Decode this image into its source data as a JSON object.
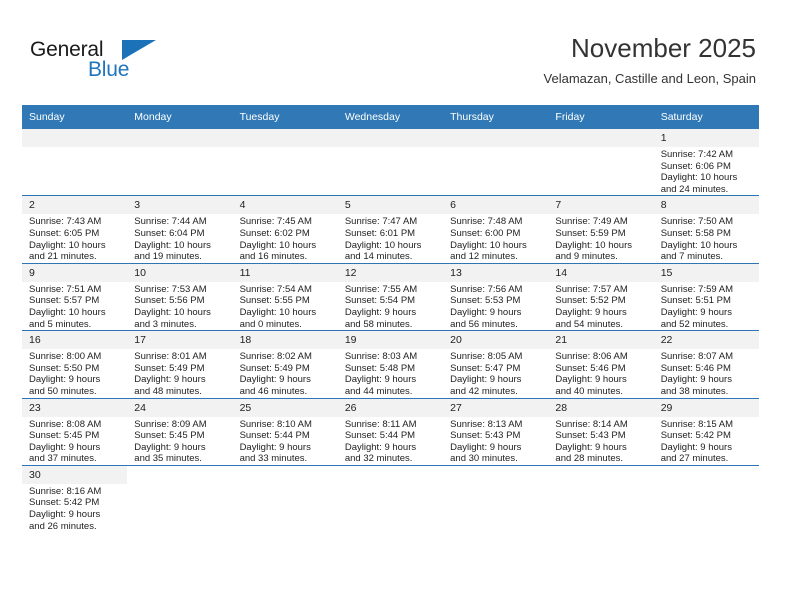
{
  "brand": {
    "name_part1": "General",
    "name_part2": "Blue",
    "accent_color": "#2175bd",
    "triangle_icon": "triangle-icon"
  },
  "header": {
    "title": "November 2025",
    "subtitle": "Velamazan, Castille and Leon, Spain"
  },
  "calendar": {
    "header_bg": "#3079b6",
    "row_line_color": "#2e75b6",
    "daynum_bg": "#f2f2f2",
    "weekdays": [
      "Sunday",
      "Monday",
      "Tuesday",
      "Wednesday",
      "Thursday",
      "Friday",
      "Saturday"
    ],
    "weeks": [
      [
        {
          "day": "",
          "lines": [],
          "empty": true
        },
        {
          "day": "",
          "lines": [],
          "empty": true
        },
        {
          "day": "",
          "lines": [],
          "empty": true
        },
        {
          "day": "",
          "lines": [],
          "empty": true
        },
        {
          "day": "",
          "lines": [],
          "empty": true
        },
        {
          "day": "",
          "lines": [],
          "empty": true
        },
        {
          "day": "1",
          "lines": [
            "Sunrise: 7:42 AM",
            "Sunset: 6:06 PM",
            "Daylight: 10 hours",
            "and 24 minutes."
          ]
        }
      ],
      [
        {
          "day": "2",
          "lines": [
            "Sunrise: 7:43 AM",
            "Sunset: 6:05 PM",
            "Daylight: 10 hours",
            "and 21 minutes."
          ]
        },
        {
          "day": "3",
          "lines": [
            "Sunrise: 7:44 AM",
            "Sunset: 6:04 PM",
            "Daylight: 10 hours",
            "and 19 minutes."
          ]
        },
        {
          "day": "4",
          "lines": [
            "Sunrise: 7:45 AM",
            "Sunset: 6:02 PM",
            "Daylight: 10 hours",
            "and 16 minutes."
          ]
        },
        {
          "day": "5",
          "lines": [
            "Sunrise: 7:47 AM",
            "Sunset: 6:01 PM",
            "Daylight: 10 hours",
            "and 14 minutes."
          ]
        },
        {
          "day": "6",
          "lines": [
            "Sunrise: 7:48 AM",
            "Sunset: 6:00 PM",
            "Daylight: 10 hours",
            "and 12 minutes."
          ]
        },
        {
          "day": "7",
          "lines": [
            "Sunrise: 7:49 AM",
            "Sunset: 5:59 PM",
            "Daylight: 10 hours",
            "and 9 minutes."
          ]
        },
        {
          "day": "8",
          "lines": [
            "Sunrise: 7:50 AM",
            "Sunset: 5:58 PM",
            "Daylight: 10 hours",
            "and 7 minutes."
          ]
        }
      ],
      [
        {
          "day": "9",
          "lines": [
            "Sunrise: 7:51 AM",
            "Sunset: 5:57 PM",
            "Daylight: 10 hours",
            "and 5 minutes."
          ]
        },
        {
          "day": "10",
          "lines": [
            "Sunrise: 7:53 AM",
            "Sunset: 5:56 PM",
            "Daylight: 10 hours",
            "and 3 minutes."
          ]
        },
        {
          "day": "11",
          "lines": [
            "Sunrise: 7:54 AM",
            "Sunset: 5:55 PM",
            "Daylight: 10 hours",
            "and 0 minutes."
          ]
        },
        {
          "day": "12",
          "lines": [
            "Sunrise: 7:55 AM",
            "Sunset: 5:54 PM",
            "Daylight: 9 hours",
            "and 58 minutes."
          ]
        },
        {
          "day": "13",
          "lines": [
            "Sunrise: 7:56 AM",
            "Sunset: 5:53 PM",
            "Daylight: 9 hours",
            "and 56 minutes."
          ]
        },
        {
          "day": "14",
          "lines": [
            "Sunrise: 7:57 AM",
            "Sunset: 5:52 PM",
            "Daylight: 9 hours",
            "and 54 minutes."
          ]
        },
        {
          "day": "15",
          "lines": [
            "Sunrise: 7:59 AM",
            "Sunset: 5:51 PM",
            "Daylight: 9 hours",
            "and 52 minutes."
          ]
        }
      ],
      [
        {
          "day": "16",
          "lines": [
            "Sunrise: 8:00 AM",
            "Sunset: 5:50 PM",
            "Daylight: 9 hours",
            "and 50 minutes."
          ]
        },
        {
          "day": "17",
          "lines": [
            "Sunrise: 8:01 AM",
            "Sunset: 5:49 PM",
            "Daylight: 9 hours",
            "and 48 minutes."
          ]
        },
        {
          "day": "18",
          "lines": [
            "Sunrise: 8:02 AM",
            "Sunset: 5:49 PM",
            "Daylight: 9 hours",
            "and 46 minutes."
          ]
        },
        {
          "day": "19",
          "lines": [
            "Sunrise: 8:03 AM",
            "Sunset: 5:48 PM",
            "Daylight: 9 hours",
            "and 44 minutes."
          ]
        },
        {
          "day": "20",
          "lines": [
            "Sunrise: 8:05 AM",
            "Sunset: 5:47 PM",
            "Daylight: 9 hours",
            "and 42 minutes."
          ]
        },
        {
          "day": "21",
          "lines": [
            "Sunrise: 8:06 AM",
            "Sunset: 5:46 PM",
            "Daylight: 9 hours",
            "and 40 minutes."
          ]
        },
        {
          "day": "22",
          "lines": [
            "Sunrise: 8:07 AM",
            "Sunset: 5:46 PM",
            "Daylight: 9 hours",
            "and 38 minutes."
          ]
        }
      ],
      [
        {
          "day": "23",
          "lines": [
            "Sunrise: 8:08 AM",
            "Sunset: 5:45 PM",
            "Daylight: 9 hours",
            "and 37 minutes."
          ]
        },
        {
          "day": "24",
          "lines": [
            "Sunrise: 8:09 AM",
            "Sunset: 5:45 PM",
            "Daylight: 9 hours",
            "and 35 minutes."
          ]
        },
        {
          "day": "25",
          "lines": [
            "Sunrise: 8:10 AM",
            "Sunset: 5:44 PM",
            "Daylight: 9 hours",
            "and 33 minutes."
          ]
        },
        {
          "day": "26",
          "lines": [
            "Sunrise: 8:11 AM",
            "Sunset: 5:44 PM",
            "Daylight: 9 hours",
            "and 32 minutes."
          ]
        },
        {
          "day": "27",
          "lines": [
            "Sunrise: 8:13 AM",
            "Sunset: 5:43 PM",
            "Daylight: 9 hours",
            "and 30 minutes."
          ]
        },
        {
          "day": "28",
          "lines": [
            "Sunrise: 8:14 AM",
            "Sunset: 5:43 PM",
            "Daylight: 9 hours",
            "and 28 minutes."
          ]
        },
        {
          "day": "29",
          "lines": [
            "Sunrise: 8:15 AM",
            "Sunset: 5:42 PM",
            "Daylight: 9 hours",
            "and 27 minutes."
          ]
        }
      ],
      [
        {
          "day": "30",
          "lines": [
            "Sunrise: 8:16 AM",
            "Sunset: 5:42 PM",
            "Daylight: 9 hours",
            "and 26 minutes."
          ]
        },
        {
          "day": "",
          "lines": [],
          "blank": true
        },
        {
          "day": "",
          "lines": [],
          "blank": true
        },
        {
          "day": "",
          "lines": [],
          "blank": true
        },
        {
          "day": "",
          "lines": [],
          "blank": true
        },
        {
          "day": "",
          "lines": [],
          "blank": true
        },
        {
          "day": "",
          "lines": [],
          "blank": true
        }
      ]
    ]
  }
}
